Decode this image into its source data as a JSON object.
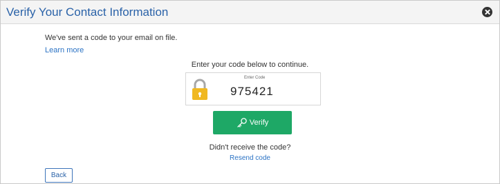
{
  "dialog": {
    "title": "Verify Your Contact Information",
    "close_icon": "close-circle-icon"
  },
  "message": {
    "sent": "We've sent a code to your email on file.",
    "learn_more": "Learn more"
  },
  "code_entry": {
    "instruction": "Enter your code below to continue.",
    "label": "Enter Code",
    "value": "975421",
    "icon": "padlock-icon",
    "icon_color": "#f0b821"
  },
  "verify_button": {
    "label": "Verify",
    "icon": "key-icon",
    "color": "#1ea866"
  },
  "resend": {
    "prompt": "Didn't receive the code?",
    "link": "Resend code"
  },
  "back_button": {
    "label": "Back"
  },
  "colors": {
    "title": "#2a62a8",
    "link": "#2a72c4",
    "header_bg": "#f4f4f4"
  }
}
